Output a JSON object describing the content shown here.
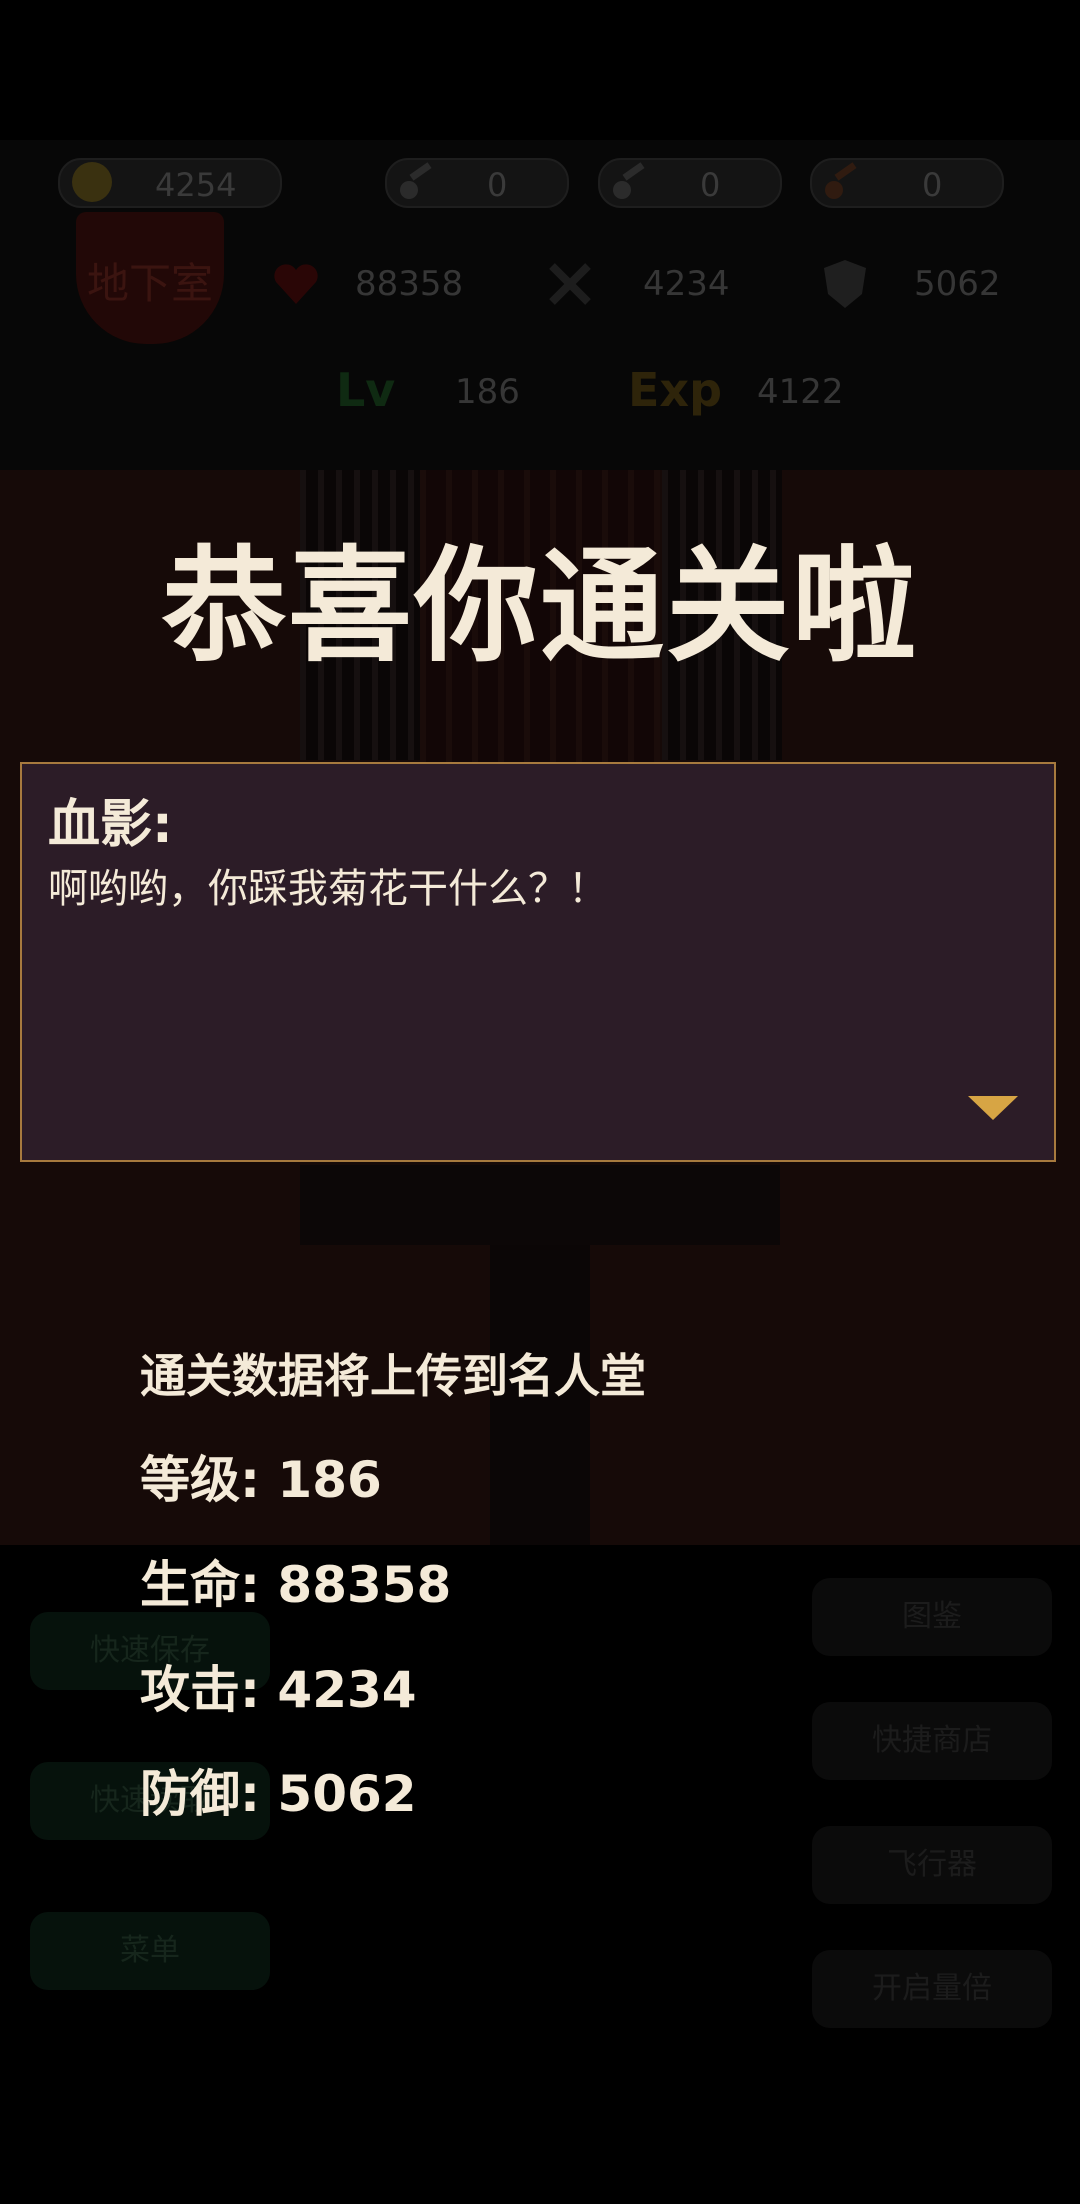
{
  "resources": {
    "gold": "4254",
    "key1": "0",
    "key2": "0",
    "key3": "0"
  },
  "floor": "地下室",
  "stats": {
    "hp": "88358",
    "atk": "4234",
    "def": "5062",
    "lv_label": "Lv",
    "lv": "186",
    "exp_label": "Exp",
    "exp": "4122"
  },
  "title": "恭喜你通关啦",
  "dialog": {
    "speaker": "血影:",
    "line": "啊哟哟，你踩我菊花干什么？！"
  },
  "result": {
    "header": "通关数据将上传到名人堂",
    "level": "等级: 186",
    "hp": "生命: 88358",
    "atk": "攻击: 4234",
    "def": "防御: 5062"
  },
  "buttons": {
    "quick_save": "快速保存",
    "quick_load": "快速读取",
    "menu": "菜单",
    "codex": "图鉴",
    "quick_shop": "快捷商店",
    "flyer": "飞行器",
    "speedup": "开启量倍"
  },
  "colors": {
    "accent_gold": "#d7a544",
    "dialog_bg": "#2c1c27",
    "dialog_border": "#a77a3e",
    "text": "#f4ead8"
  }
}
